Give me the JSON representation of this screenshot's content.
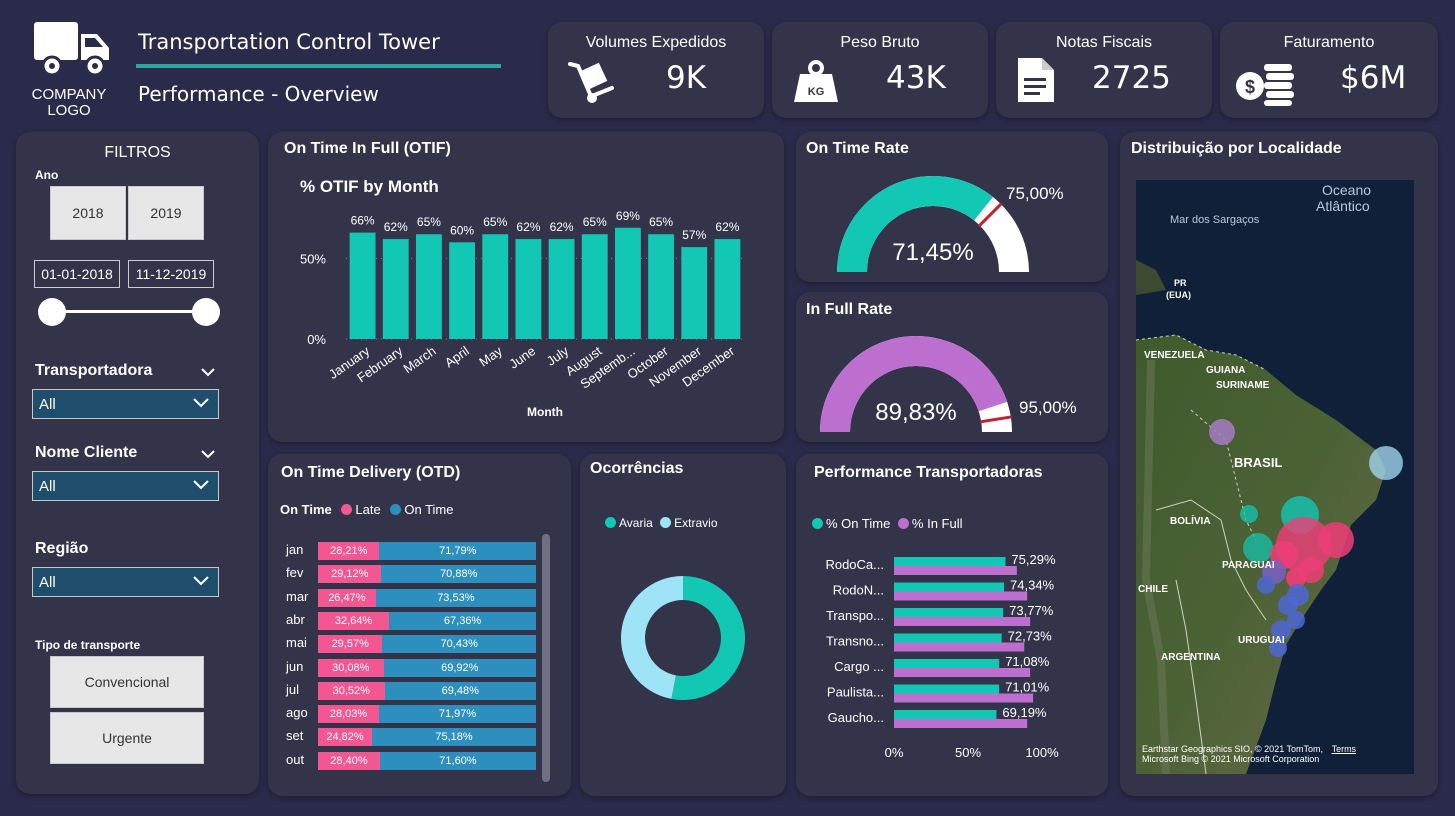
{
  "header": {
    "logo_line1": "COMPANY",
    "logo_line2": "LOGO",
    "title": "Transportation Control Tower",
    "subtitle": "Performance - Overview",
    "accent_color": "#2ea6a0"
  },
  "kpis": [
    {
      "label": "Volumes Expedidos",
      "value": "9K",
      "icon": "hand-truck-icon"
    },
    {
      "label": "Peso Bruto",
      "value": "43K",
      "icon": "weight-icon",
      "icon_text": "KG"
    },
    {
      "label": "Notas Fiscais",
      "value": "2725",
      "icon": "document-icon"
    },
    {
      "label": "Faturamento",
      "value": "$6M",
      "icon": "money-icon"
    }
  ],
  "filters": {
    "title": "FILTROS",
    "ano_label": "Ano",
    "years": [
      "2018",
      "2019"
    ],
    "date_start": "01-01-2018",
    "date_end": "11-12-2019",
    "transportadora_label": "Transportadora",
    "transportadora_value": "All",
    "cliente_label": "Nome Cliente",
    "cliente_value": "All",
    "regiao_label": "Região",
    "regiao_value": "All",
    "tipo_label": "Tipo de transporte",
    "tipo_options": [
      "Convencional",
      "Urgente"
    ]
  },
  "otif": {
    "card_title": "On Time In Full (OTIF)",
    "color": "#12c7b3",
    "chart_data": {
      "type": "bar",
      "title": "% OTIF by Month",
      "xlabel": "Month",
      "ylabel": "",
      "categories": [
        "January",
        "February",
        "March",
        "April",
        "May",
        "June",
        "July",
        "August",
        "Septemb...",
        "October",
        "November",
        "December"
      ],
      "values": [
        66,
        62,
        65,
        60,
        65,
        62,
        62,
        65,
        69,
        65,
        57,
        62
      ],
      "value_labels": [
        "66%",
        "62%",
        "65%",
        "60%",
        "65%",
        "62%",
        "62%",
        "65%",
        "69%",
        "65%",
        "57%",
        "62%"
      ],
      "y_ticks": [
        "0%",
        "50%"
      ],
      "ylim": [
        0,
        85
      ]
    }
  },
  "on_time_rate": {
    "card_title": "On Time Rate",
    "value": 71.45,
    "value_label": "71,45%",
    "target": 75.0,
    "target_label": "75,00%",
    "color": "#12c7b3"
  },
  "in_full_rate": {
    "card_title": "In Full Rate",
    "value": 89.83,
    "value_label": "89,83%",
    "target": 95.0,
    "target_label": "95,00%",
    "color": "#bd6fcf"
  },
  "map": {
    "card_title": "Distribuição por Localidade",
    "labels": {
      "ocean1": "Oceano",
      "ocean2": "Atlântico",
      "sargasso": "Mar dos Sargaços",
      "pr1": "PR",
      "pr2": "(EUA)",
      "venezuela": "VENEZUELA",
      "guiana": "GUIANA",
      "suriname": "SURINAME",
      "brasil": "BRASIL",
      "bolivia": "BOLÍVIA",
      "paraguai": "PARAGUAI",
      "chile": "CHILE",
      "uruguai": "URUGUAI",
      "argentina": "ARGENTINA"
    },
    "attribution1": "Earthstar Geographics SIO, © 2021 TomTom,",
    "attribution_link": "Terms",
    "attribution2": "Microsoft Bing",
    "attribution3": "© 2021 Microsoft Corporation"
  },
  "otd": {
    "card_title": "On Time Delivery (OTD)",
    "legend_title": "On Time",
    "legend": [
      {
        "name": "Late",
        "color": "#f25792"
      },
      {
        "name": "On Time",
        "color": "#2c8fbd"
      }
    ],
    "chart_data": {
      "type": "bar",
      "orientation": "horizontal-stacked-100",
      "categories": [
        "jan",
        "fev",
        "mar",
        "abr",
        "mai",
        "jun",
        "jul",
        "ago",
        "set",
        "out"
      ],
      "series": [
        {
          "name": "Late",
          "values": [
            28.21,
            29.12,
            26.47,
            32.64,
            29.57,
            30.08,
            30.52,
            28.03,
            24.82,
            28.4
          ],
          "labels": [
            "28,21%",
            "29,12%",
            "26,47%",
            "32,64%",
            "29,57%",
            "30,08%",
            "30,52%",
            "28,03%",
            "24,82%",
            "28,40%"
          ]
        },
        {
          "name": "On Time",
          "values": [
            71.79,
            70.88,
            73.53,
            67.36,
            70.43,
            69.92,
            69.48,
            71.97,
            75.18,
            71.6
          ],
          "labels": [
            "71,79%",
            "70,88%",
            "73,53%",
            "67,36%",
            "70,43%",
            "69,92%",
            "69,48%",
            "71,97%",
            "75,18%",
            "71,60%"
          ]
        }
      ]
    }
  },
  "ocorrencias": {
    "card_title": "Ocorrências",
    "legend": [
      {
        "name": "Avaria",
        "color": "#12c7b3"
      },
      {
        "name": "Extravio",
        "color": "#9fe3f7"
      }
    ],
    "chart_data": {
      "type": "pie",
      "variant": "donut",
      "categories": [
        "Avaria",
        "Extravio"
      ],
      "values": [
        53,
        47
      ]
    }
  },
  "performance": {
    "card_title": "Performance Transportadoras",
    "legend": [
      {
        "name": "% On Time",
        "color": "#12c7b3"
      },
      {
        "name": "% In Full",
        "color": "#bd6fcf"
      }
    ],
    "chart_data": {
      "type": "bar",
      "orientation": "horizontal-grouped",
      "categories": [
        "RodoCa...",
        "RodoN...",
        "Transpo...",
        "Transno...",
        "Cargo ...",
        "Paulista...",
        "Gaucho..."
      ],
      "series": [
        {
          "name": "% On Time",
          "values": [
            75.29,
            74.34,
            73.77,
            72.73,
            71.08,
            71.01,
            69.19
          ]
        },
        {
          "name": "% In Full",
          "values": [
            83,
            90,
            92,
            88,
            92,
            94,
            90
          ]
        }
      ],
      "data_labels": [
        "75,29%",
        "74,34%",
        "73,77%",
        "72,73%",
        "71,08%",
        "71,01%",
        "69,19%"
      ],
      "x_ticks": [
        "0%",
        "50%",
        "100%"
      ],
      "xlim": [
        0,
        100
      ]
    }
  }
}
